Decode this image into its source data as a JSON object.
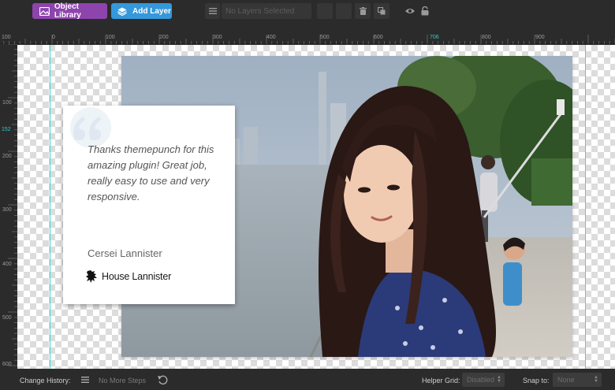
{
  "toolbar": {
    "object_library_label": "Object Library",
    "add_layer_label": "Add Layer",
    "layer_select_placeholder": "No Layers Selected"
  },
  "ruler": {
    "top_ticks": [
      "100",
      "0",
      "100",
      "200",
      "300",
      "400",
      "500",
      "600",
      "700",
      "800",
      "900"
    ],
    "left_ticks": [
      "100",
      "200",
      "300",
      "400",
      "500",
      "600"
    ],
    "cursor_x": "706",
    "cursor_y": "152"
  },
  "card": {
    "quote": "Thanks themepunch for this amazing plugin! Great job, really easy to use and very responsive.",
    "author": "Cersei Lannister",
    "house": "House Lannister"
  },
  "bottom": {
    "change_history_label": "Change History:",
    "steps_text": "No More Steps",
    "helper_grid_label": "Helper Grid:",
    "helper_grid_value": "Disabled",
    "snap_label": "Snap to:",
    "snap_value": "None"
  },
  "colors": {
    "object_library": "#8e44ad",
    "add_layer": "#3498db",
    "guide": "#46d3d3"
  }
}
